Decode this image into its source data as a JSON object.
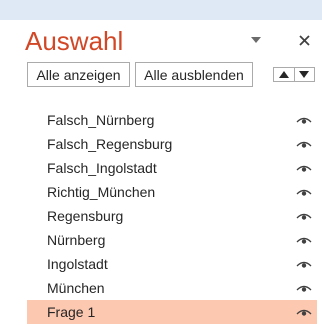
{
  "pane": {
    "title": "Auswahl"
  },
  "buttons": {
    "show_all": "Alle anzeigen",
    "hide_all": "Alle ausblenden"
  },
  "items": [
    {
      "label": "Falsch_Nürnberg",
      "visible": true,
      "selected": false
    },
    {
      "label": "Falsch_Regensburg",
      "visible": true,
      "selected": false
    },
    {
      "label": "Falsch_Ingolstadt",
      "visible": true,
      "selected": false
    },
    {
      "label": "Richtig_München",
      "visible": true,
      "selected": false
    },
    {
      "label": "Regensburg",
      "visible": true,
      "selected": false
    },
    {
      "label": "Nürnberg",
      "visible": true,
      "selected": false
    },
    {
      "label": "Ingolstadt",
      "visible": true,
      "selected": false
    },
    {
      "label": "München",
      "visible": true,
      "selected": false
    },
    {
      "label": "Frage 1",
      "visible": true,
      "selected": true
    }
  ],
  "colors": {
    "accent": "#d24726",
    "selection": "#fcc8b0",
    "topbar": "#dfe9f6"
  },
  "icons": {
    "options": "triangle-down-icon",
    "close": "close-icon",
    "move_up": "triangle-up-icon",
    "move_down": "triangle-down-icon",
    "visibility": "eye-icon"
  }
}
